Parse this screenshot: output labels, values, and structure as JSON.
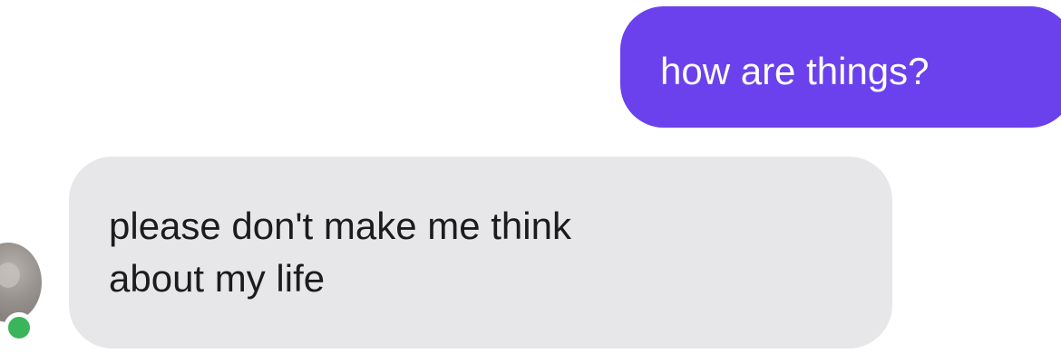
{
  "colors": {
    "sent_bubble": "#6a41ec",
    "received_bubble": "#e7e7ea",
    "online_indicator": "#3bb55b"
  },
  "messages": {
    "sent": {
      "text": "how are things?"
    },
    "received": {
      "lines": [
        "please don't make me think",
        "about my life"
      ]
    }
  },
  "contact": {
    "avatar_icon": "avatar-icon",
    "status_icon": "online-status-icon"
  }
}
